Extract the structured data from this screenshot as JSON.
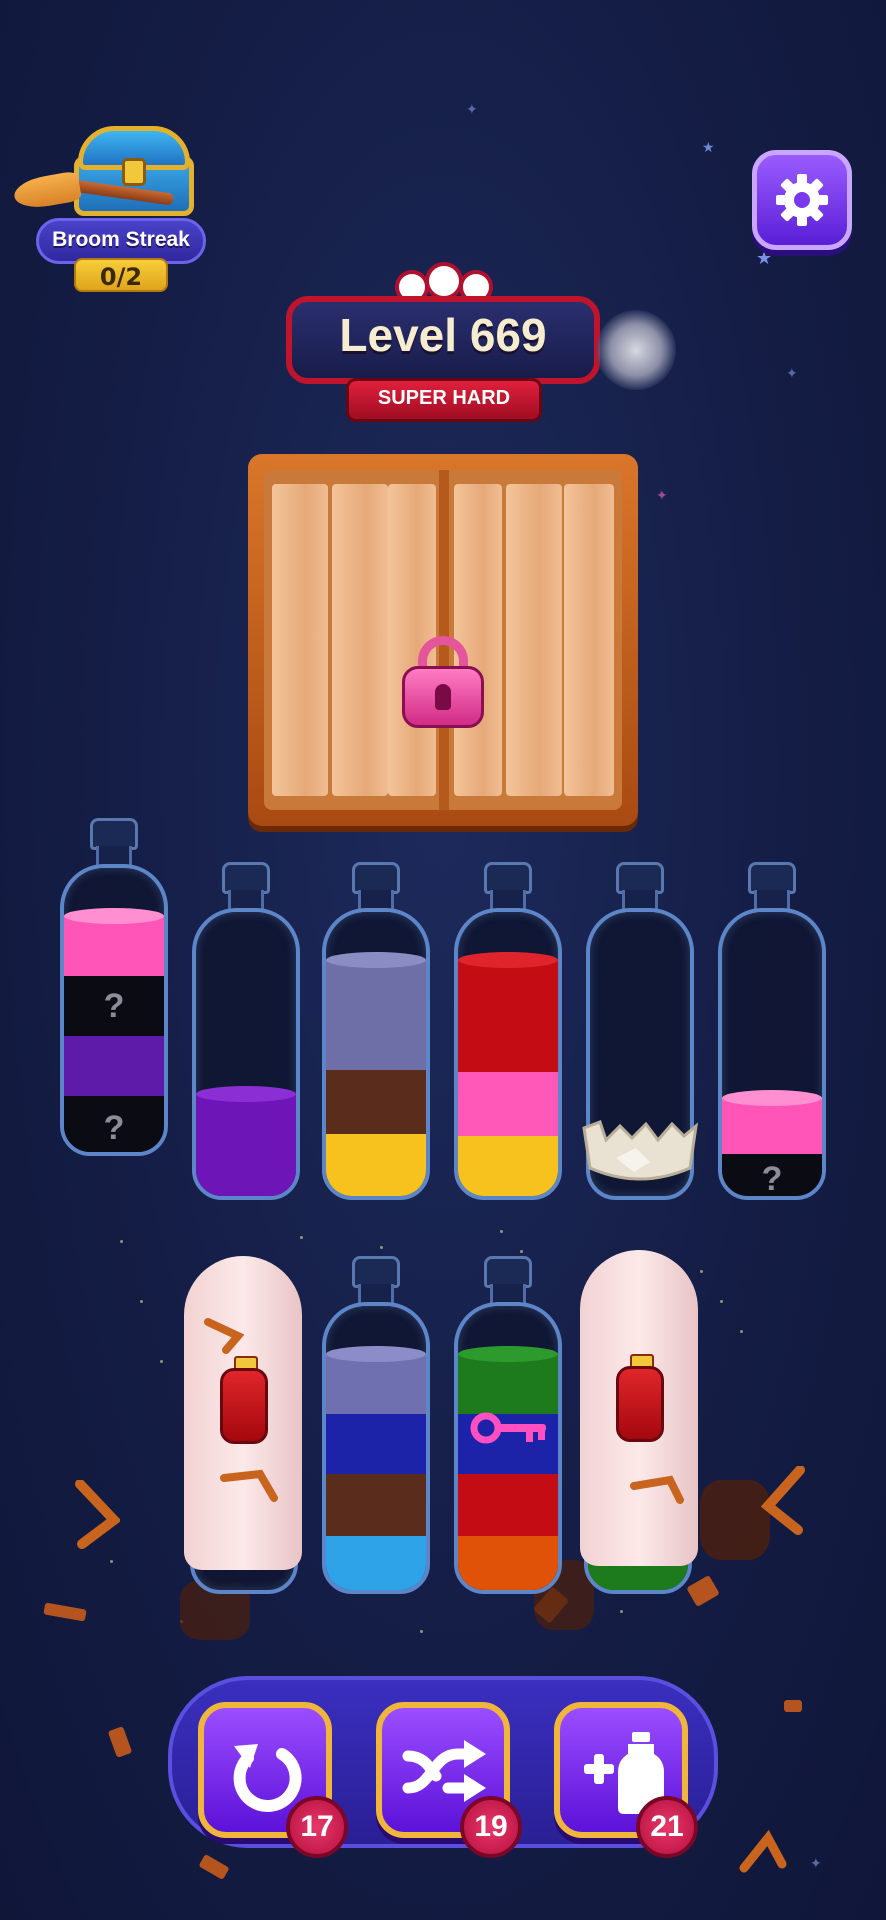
{
  "streak": {
    "title": "Broom Streak",
    "progress": "0/2"
  },
  "level": {
    "label": "Level 669",
    "difficulty": "SUPER HARD",
    "skull_count": 3
  },
  "locked_box": {
    "lock_color": "#e4559c"
  },
  "bottles_top": [
    {
      "layers": [
        {
          "color": "#ff55b8"
        },
        {
          "color": "#0b0b14",
          "label": "?"
        },
        {
          "color": "#5e1aa8"
        },
        {
          "color": "#0b0b14",
          "label": "?"
        }
      ]
    },
    {
      "layers": [
        {
          "color": "#6e15b8"
        }
      ]
    },
    {
      "layers": [
        {
          "color": "#6f6fa8"
        },
        {
          "color": "#5a2c1c"
        },
        {
          "color": "#f7c21e"
        }
      ]
    },
    {
      "layers": [
        {
          "color": "#c40c14"
        },
        {
          "color": "#ff58b8"
        },
        {
          "color": "#f7c21e"
        }
      ]
    },
    {
      "layers": [],
      "state": "ice-base"
    },
    {
      "layers": [
        {
          "color": "#ff55b8"
        },
        {
          "color": "#0b0b14",
          "label": "?"
        }
      ]
    }
  ],
  "bottles_bottom": [
    {
      "state": "covered"
    },
    {
      "layers": [
        {
          "color": "#6f70b0"
        },
        {
          "color": "#1d23a8"
        },
        {
          "color": "#5a2c1c"
        },
        {
          "color": "#2fa3e8"
        }
      ]
    },
    {
      "layers": [
        {
          "color": "#1d7a1d"
        },
        {
          "color": "#1d23a8"
        },
        {
          "color": "#c40c14"
        },
        {
          "color": "#e05208"
        }
      ],
      "item": "key-icon"
    },
    {
      "state": "covered"
    }
  ],
  "boosters": [
    {
      "icon": "undo-icon",
      "count": "17"
    },
    {
      "icon": "shuffle-icon",
      "count": "19"
    },
    {
      "icon": "add-bottle-icon",
      "count": "21"
    }
  ]
}
